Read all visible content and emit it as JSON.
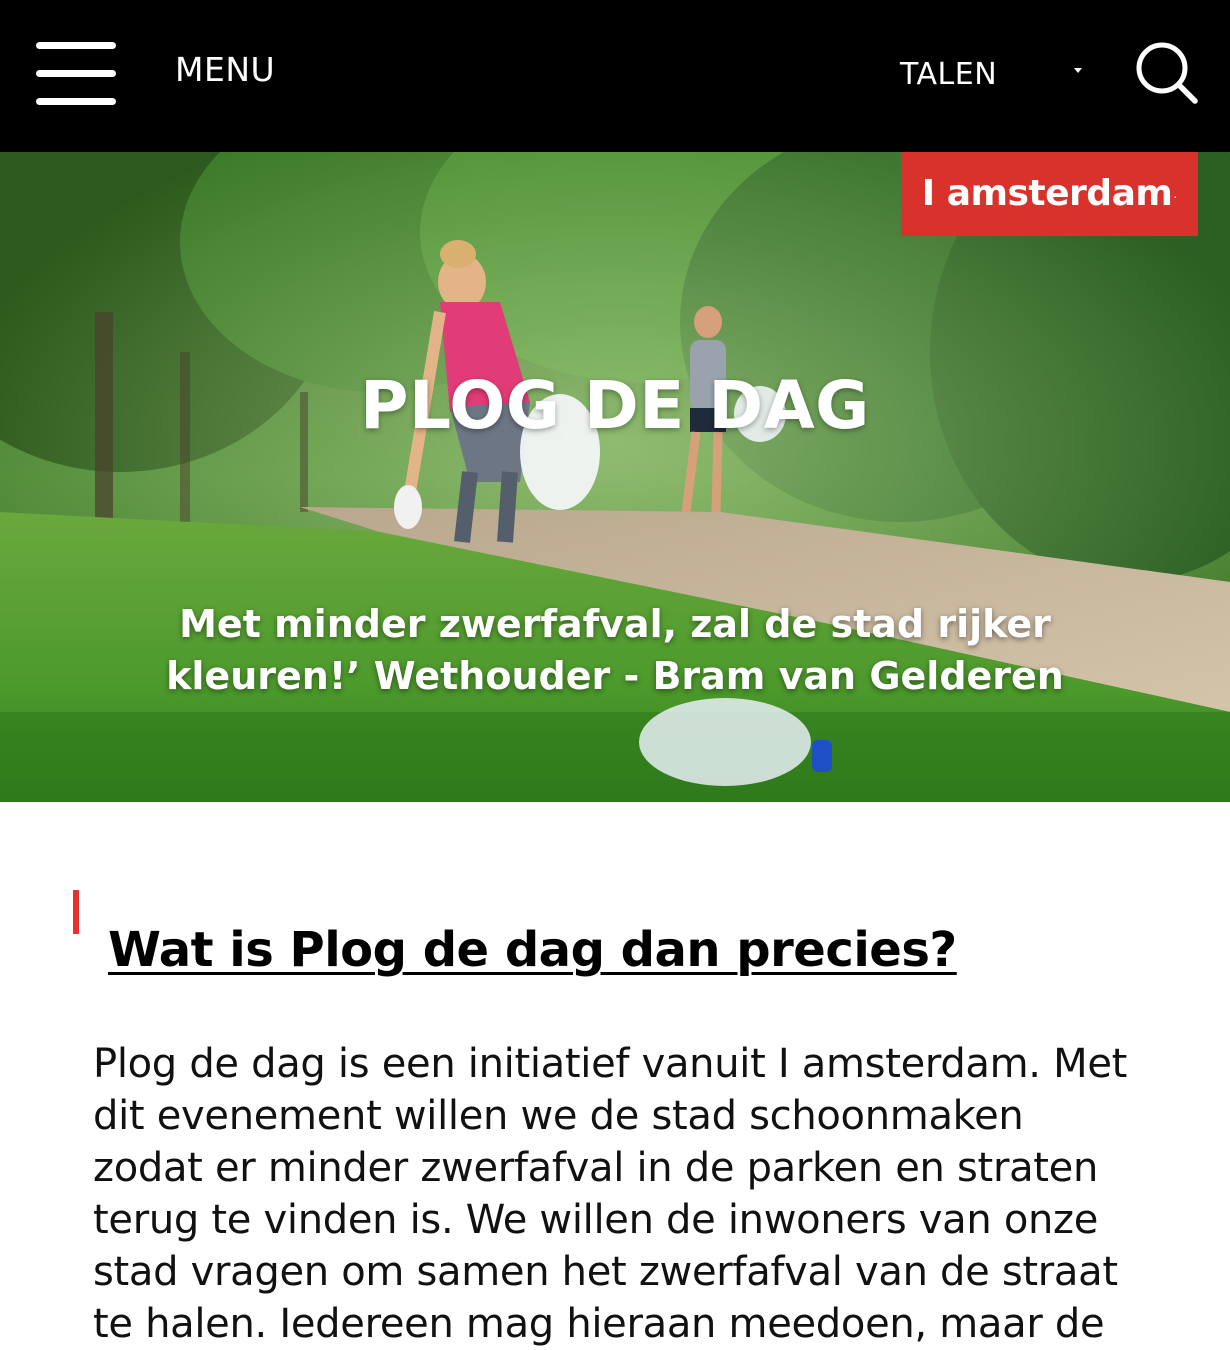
{
  "header": {
    "menu_label": "MENU",
    "language_label": "TALEN"
  },
  "hero": {
    "brand_name": "I amsterdam",
    "brand_trademark": ".",
    "title": "PLOG DE DAG",
    "quote": "Met minder zwerfafval, zal de stad rijker kleuren!’ Wethouder - Bram van Gelderen"
  },
  "article": {
    "heading": "Wat is Plog de dag dan precies?",
    "body": "Plog de dag is een initiatief vanuit I amsterdam. Met dit evenement willen we de stad schoonmaken zodat er minder zwerfafval in de parken en straten terug te vinden is. We willen de inwoners van onze stad vragen om samen het zwerfafval van de straat te halen. Iedereen mag hieraan meedoen, maar de"
  },
  "colors": {
    "header_bg": "#000000",
    "brand_red": "#d9322d",
    "accent_red": "#e5322d"
  },
  "icons": {
    "menu": "hamburger-icon",
    "language_dropdown": "caret-down-icon",
    "search": "search-icon"
  }
}
